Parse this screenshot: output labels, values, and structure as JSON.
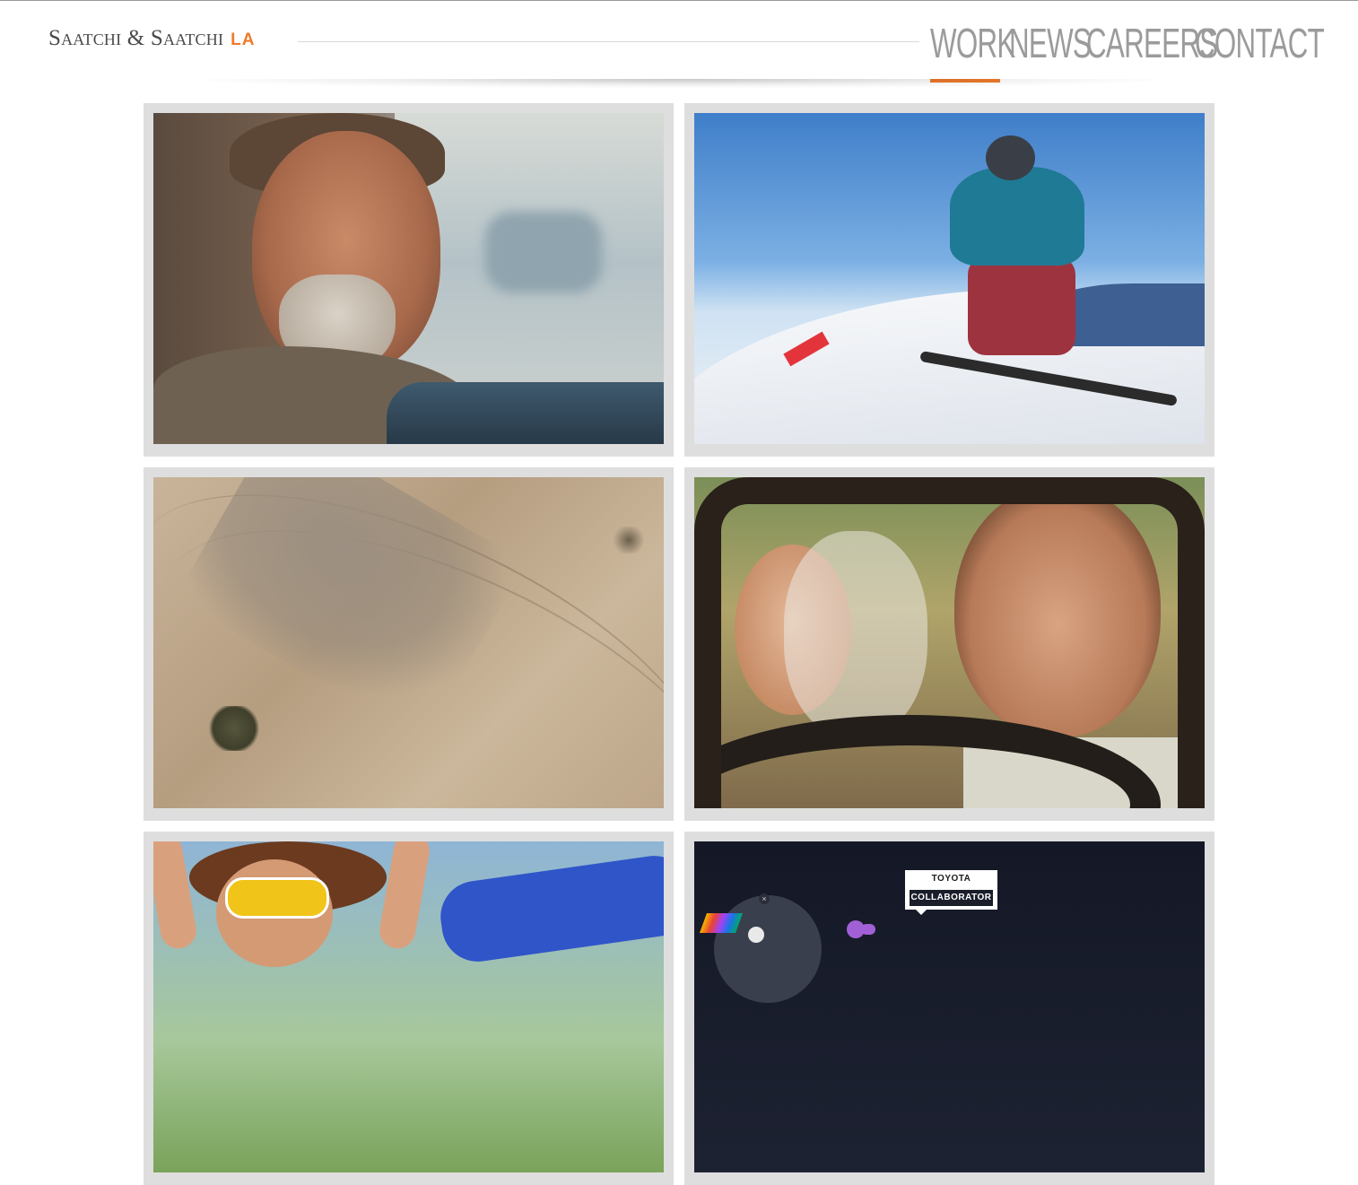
{
  "header": {
    "logo_text": "Saatchi & Saatchi",
    "logo_suffix": "LA",
    "nav": [
      {
        "label": "WORK",
        "active": true
      },
      {
        "label": "NEWS",
        "active": false
      },
      {
        "label": "CAREERS",
        "active": false
      },
      {
        "label": "CONTACT",
        "active": false
      }
    ]
  },
  "colors": {
    "accent": "#ef7a2a",
    "nav_text": "#9b9b9b",
    "tile_border": "#dedede"
  },
  "work_tiles": [
    {
      "subject": "man-driving-portrait"
    },
    {
      "subject": "snowboarder"
    },
    {
      "subject": "desert-dust-aerial"
    },
    {
      "subject": "bride-groom-car"
    },
    {
      "subject": "celebration-goggles"
    },
    {
      "subject": "toyota-collaborator",
      "badge_brand": "TOYOTA",
      "badge_label": "COLLABORATOR"
    }
  ]
}
